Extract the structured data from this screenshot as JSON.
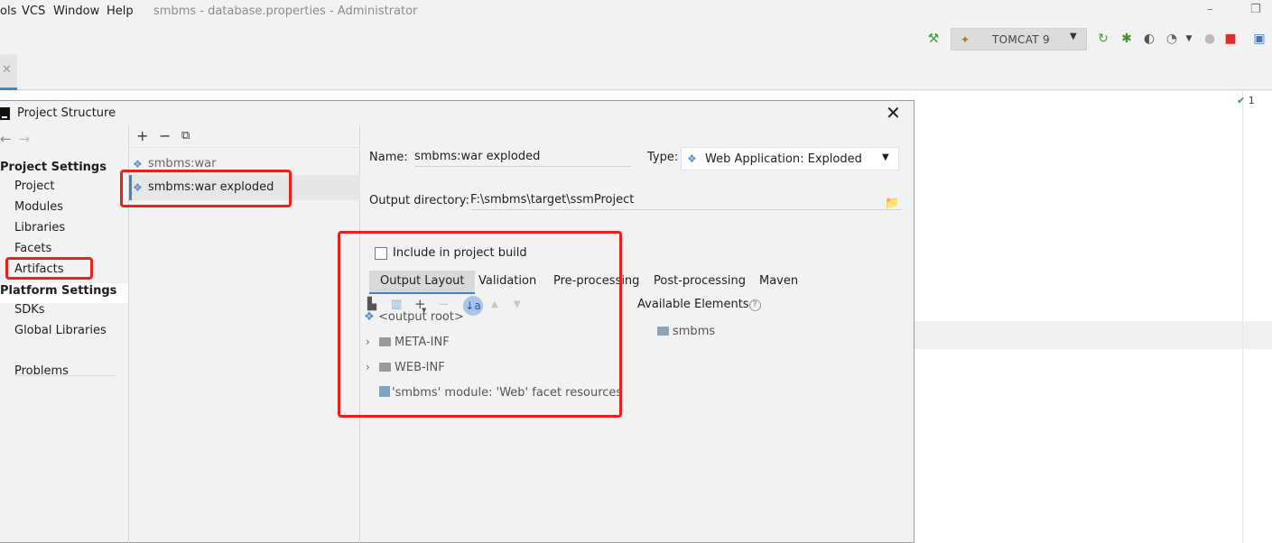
{
  "menubar": {
    "items": [
      "ols",
      "VCS",
      "Window",
      "Help"
    ],
    "title": "smbms - database.properties - Administrator"
  },
  "toolbar": {
    "run_config": "TOMCAT 9",
    "icons": [
      "hammer-icon",
      "tomcat-icon",
      "rerun-icon",
      "debug-icon",
      "coverage-icon",
      "profile-icon",
      "stop-icon",
      "project-structure-icon"
    ]
  },
  "editor": {
    "inspection_count": "1"
  },
  "dialog": {
    "title": "Project Structure",
    "nav": {
      "project_settings": "Project Settings",
      "project_items": [
        "Project",
        "Modules",
        "Libraries",
        "Facets",
        "Artifacts"
      ],
      "platform_settings": "Platform Settings",
      "platform_items": [
        "SDKs",
        "Global Libraries"
      ],
      "problems": "Problems",
      "selected": "Artifacts"
    },
    "artifacts": [
      {
        "label": "smbms:war",
        "selected": false
      },
      {
        "label": "smbms:war exploded",
        "selected": true
      }
    ],
    "detail": {
      "name_label": "Name:",
      "name_value": "smbms:war exploded",
      "type_label": "Type:",
      "type_value": "Web Application: Exploded",
      "output_dir_label": "Output directory:",
      "output_dir_value": "F:\\smbms\\target\\ssmProject",
      "include_build_label": "Include in project build",
      "include_build_checked": false,
      "tabs": [
        "Output Layout",
        "Validation",
        "Pre-processing",
        "Post-processing",
        "Maven"
      ],
      "active_tab": "Output Layout",
      "tree": {
        "root": "<output root>",
        "children": [
          "META-INF",
          "WEB-INF",
          "'smbms' module: 'Web' facet resources"
        ]
      },
      "available_label": "Available Elements",
      "available_items": [
        "smbms"
      ]
    }
  },
  "colors": {
    "accent": "#4083c9",
    "annotation": "#e8201e",
    "selection": "#e6e6e6"
  }
}
